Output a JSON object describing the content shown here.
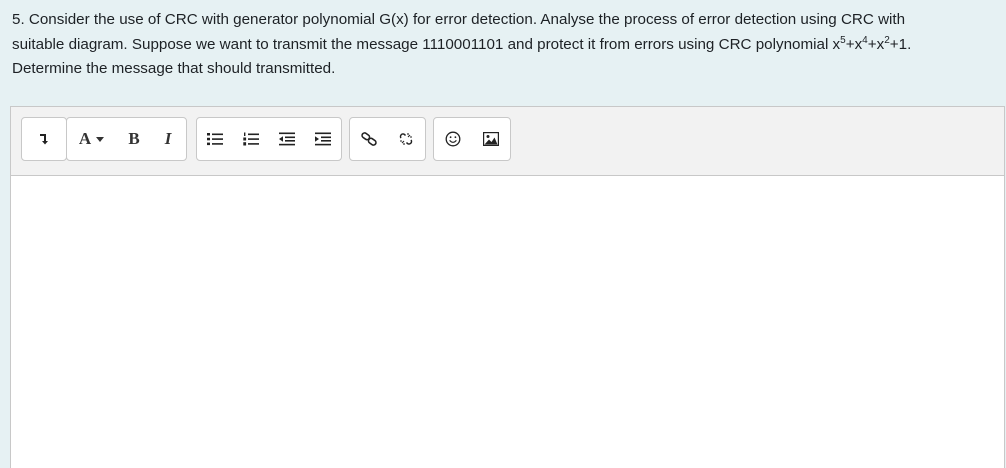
{
  "question": {
    "line1": "5. Consider the use of CRC with generator polynomial G(x) for error detection. Analyse the process of error detection using CRC with",
    "line2_prefix": "suitable diagram. Suppose we want to transmit the message 1110001101 and protect it from errors using CRC polynomial x",
    "exp1": "5",
    "mid1": "+x",
    "exp2": "4",
    "mid2": "+x",
    "exp3": "2",
    "suffix": "+1.",
    "line3": "Determine the message that should transmitted."
  },
  "toolbar": {
    "font_color_label": "A",
    "bold_label": "B",
    "italic_label": "I",
    "icons": [
      "show-more-icon",
      "font-color-icon",
      "bold-icon",
      "italic-icon",
      "unordered-list-icon",
      "ordered-list-icon",
      "outdent-icon",
      "indent-icon",
      "link-icon",
      "unlink-icon",
      "emoji-icon",
      "image-icon"
    ]
  },
  "editor": {
    "content": ""
  }
}
